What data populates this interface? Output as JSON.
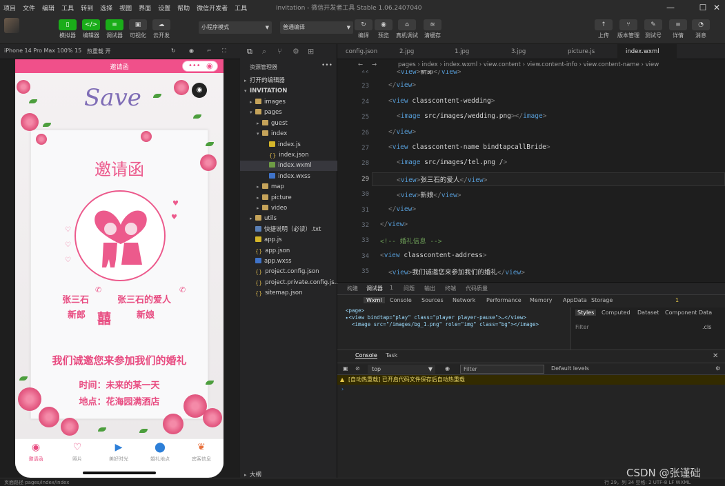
{
  "window": {
    "title": "invitation - 微信开发者工具 Stable 1.06.2407040",
    "menu": [
      "项目",
      "文件",
      "编辑",
      "工具",
      "转到",
      "选择",
      "视图",
      "界面",
      "设置",
      "帮助",
      "微信开发者",
      "工具"
    ]
  },
  "toolbar": {
    "left": [
      {
        "label": "模拟器",
        "icon": "phone-icon"
      },
      {
        "label": "编辑器",
        "icon": "code-icon"
      },
      {
        "label": "调试器",
        "icon": "debug-icon"
      },
      {
        "label": "可视化",
        "icon": "layout-icon"
      },
      {
        "label": "云开发",
        "icon": "cloud-icon"
      }
    ],
    "mode": "小程序模式",
    "compile": "普通编译",
    "mid": [
      {
        "label": "编译"
      },
      {
        "label": "预览"
      },
      {
        "label": "真机调试"
      },
      {
        "label": "清缓存"
      }
    ],
    "right": [
      {
        "label": "上传"
      },
      {
        "label": "版本管理"
      },
      {
        "label": "测试号"
      },
      {
        "label": "详情"
      },
      {
        "label": "消息"
      }
    ]
  },
  "simulator": {
    "device": "iPhone 14 Pro Max 100% 15",
    "hotreload": "热重载 开",
    "nav_title": "邀请函",
    "save_text": "Save",
    "heading": "邀请函",
    "groom_name": "张三石",
    "bride_name": "张三石的爱人",
    "groom_label": "新郎",
    "bride_label": "新娘",
    "xi": "囍",
    "invite_text": "我们诚邀您来参加我们的婚礼",
    "time_label": "时间：",
    "time_value": "未来的某一天",
    "place_label": "地点：",
    "place_value": "花海园满酒店",
    "tabs": [
      {
        "label": "邀请函",
        "icon": "invitation-icon",
        "active": true
      },
      {
        "label": "照片",
        "icon": "photo-icon"
      },
      {
        "label": "美好时光",
        "icon": "video-icon"
      },
      {
        "label": "婚礼地点",
        "icon": "location-icon"
      },
      {
        "label": "宾客信息",
        "icon": "guest-icon"
      }
    ]
  },
  "explorer": {
    "title": "资源管理器",
    "open_editors": "打开的编辑器",
    "project": "INVITATION",
    "outline": "大纲",
    "items": [
      {
        "name": "images",
        "type": "folder",
        "depth": 1,
        "caret": "▸"
      },
      {
        "name": "pages",
        "type": "folder",
        "depth": 1,
        "caret": "▾"
      },
      {
        "name": "guest",
        "type": "folder",
        "depth": 2,
        "caret": "▸"
      },
      {
        "name": "index",
        "type": "folder",
        "depth": 2,
        "caret": "▾"
      },
      {
        "name": "index.js",
        "type": "js",
        "depth": 3
      },
      {
        "name": "index.json",
        "type": "json",
        "depth": 3
      },
      {
        "name": "index.wxml",
        "type": "wx",
        "depth": 3,
        "selected": true
      },
      {
        "name": "index.wxss",
        "type": "wxss",
        "depth": 3
      },
      {
        "name": "map",
        "type": "folder",
        "depth": 2,
        "caret": "▸"
      },
      {
        "name": "picture",
        "type": "folder",
        "depth": 2,
        "caret": "▸"
      },
      {
        "name": "video",
        "type": "folder",
        "depth": 2,
        "caret": "▸"
      },
      {
        "name": "utils",
        "type": "folder",
        "depth": 1,
        "caret": "▸"
      },
      {
        "name": "快捷说明（必读）.txt",
        "type": "txt",
        "depth": 1
      },
      {
        "name": "app.js",
        "type": "js",
        "depth": 1
      },
      {
        "name": "app.json",
        "type": "json",
        "depth": 1
      },
      {
        "name": "app.wxss",
        "type": "wxss",
        "depth": 1
      },
      {
        "name": "project.config.json",
        "type": "json",
        "depth": 1
      },
      {
        "name": "project.private.config.js...",
        "type": "json",
        "depth": 1
      },
      {
        "name": "sitemap.json",
        "type": "json",
        "depth": 1
      }
    ]
  },
  "editor": {
    "tabs": [
      "config.json",
      "2.jpg",
      "1.jpg",
      "3.jpg",
      "picture.js",
      "index.wxml"
    ],
    "active_tab": "index.wxml",
    "breadcrumb": "pages › index › index.wxml › view.content › view.content-info › view.content-name › view",
    "lines": [
      {
        "n": "22",
        "code": "<view>新郎</view>"
      },
      {
        "n": "23",
        "code": "</view>"
      },
      {
        "n": "24",
        "code": "<view class=\"content-wedding\">"
      },
      {
        "n": "25",
        "code": "<image src=\"/images/wedding.png\"></image>"
      },
      {
        "n": "26",
        "code": "</view>"
      },
      {
        "n": "27",
        "code": "<view class=\"content-name\" bindtap=\"callBride\">"
      },
      {
        "n": "28",
        "code": "<image src=\"/images/tel.png\" />"
      },
      {
        "n": "29",
        "code": "<view>张三石的爱人</view>"
      },
      {
        "n": "30",
        "code": "<view>新娘</view>"
      },
      {
        "n": "31",
        "code": "</view>"
      },
      {
        "n": "32",
        "code": "</view>"
      },
      {
        "n": "33",
        "code": "<!-- 婚礼信息 -->"
      },
      {
        "n": "34",
        "code": "<view class=\"content-address\">"
      },
      {
        "n": "35",
        "code": "<view>我们诚邀您来参加我们的婚礼</view>"
      }
    ]
  },
  "devtools": {
    "panel_tabs": [
      "构建",
      "调试器",
      "1",
      "问题",
      "输出",
      "终端",
      "代码质量"
    ],
    "tabs": [
      "Wxml",
      "Console",
      "Sources",
      "Network",
      "Performance",
      "Memory",
      "AppData",
      "Storage"
    ],
    "dom": [
      "<page>",
      "▸<view bindtap=\"play\" class=\"player player-pause\">…</view>",
      "  <image src=\"/images/bg_1.png\" role=\"img\" class=\"bg\"></image>"
    ],
    "style_tabs": [
      "Styles",
      "Computed",
      "Dataset",
      "Component Data"
    ],
    "filter": "Filter",
    "cls": ".cls",
    "warn_count": "1"
  },
  "console": {
    "tabs": [
      "Console",
      "Task"
    ],
    "context": "top",
    "filter": "Filter",
    "levels": "Default levels",
    "message": "[自动热重载] 已开启代码文件保存后自动热重载",
    "prompt": "›"
  },
  "status": {
    "left": "页面路径  pages/index/index",
    "right": "行 29，列 34  空格: 2  UTF-8  LF  WXML"
  },
  "watermark": "CSDN @张谨础"
}
